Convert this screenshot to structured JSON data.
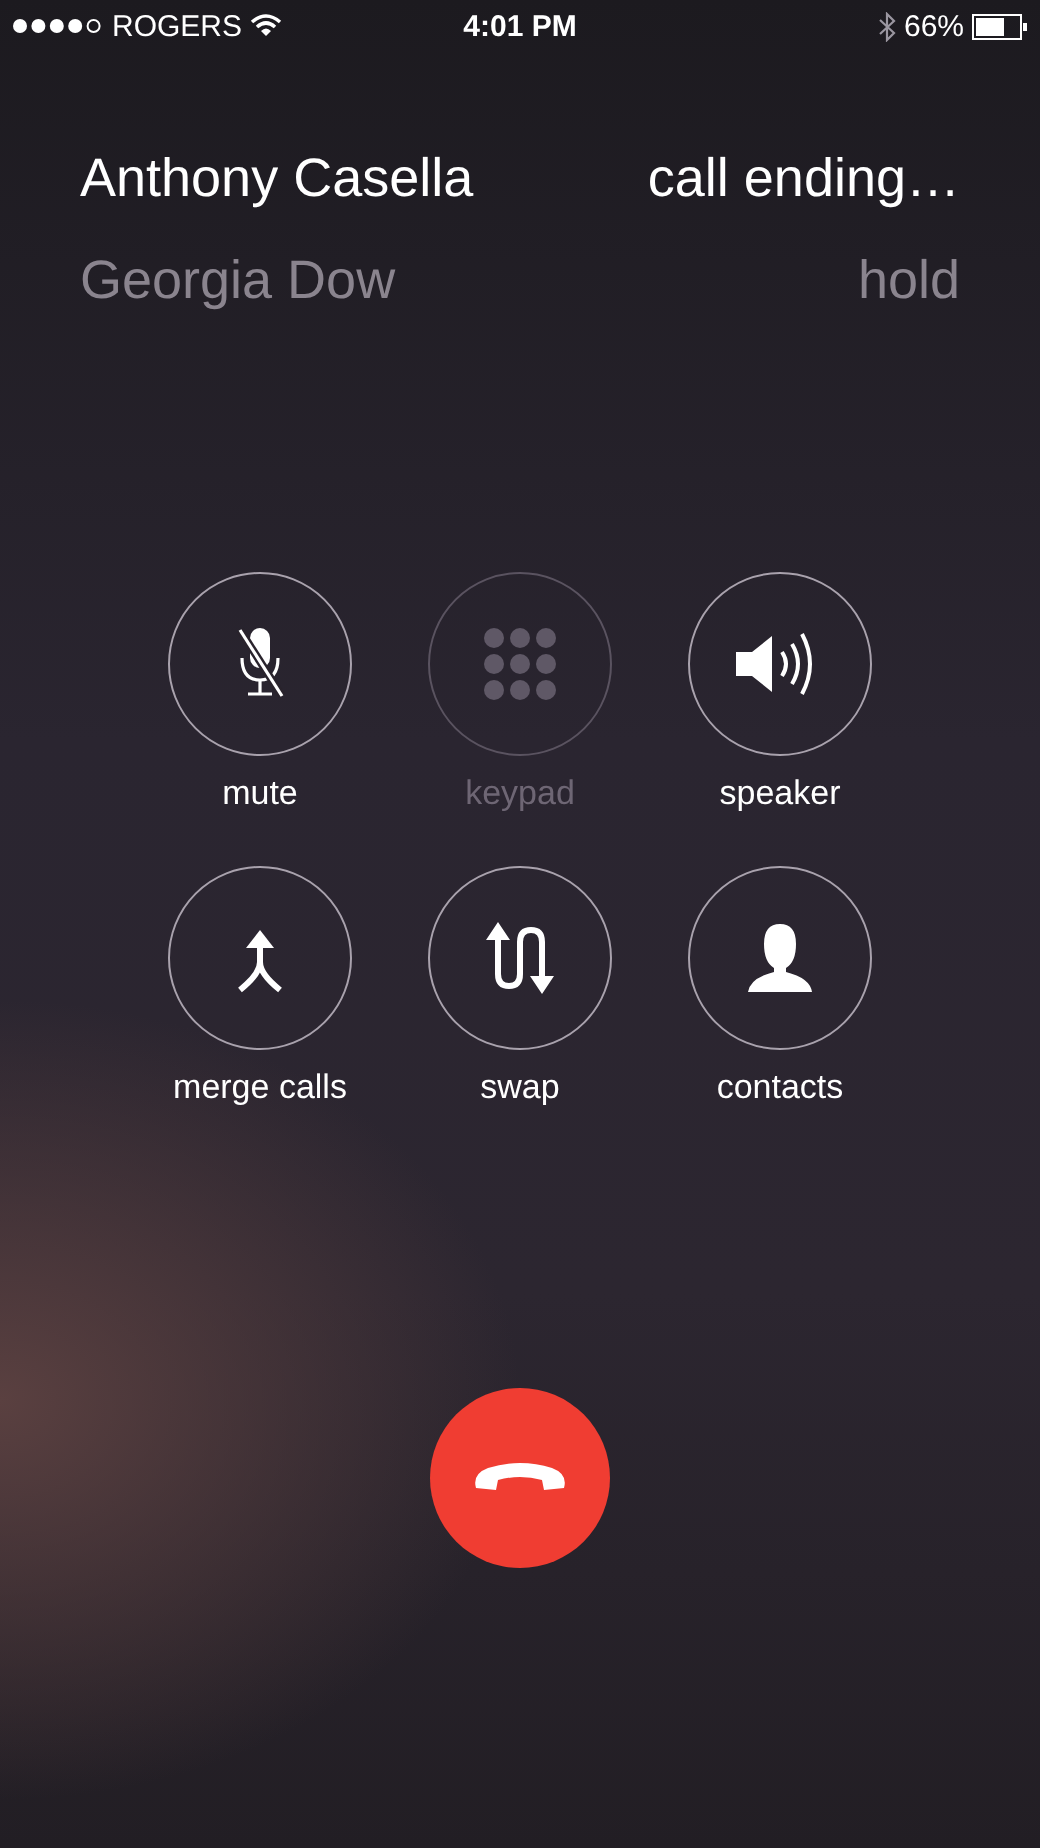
{
  "status_bar": {
    "carrier": "ROGERS",
    "time": "4:01 PM",
    "battery": "66%"
  },
  "calls": [
    {
      "name": "Anthony Casella",
      "status": "call ending…",
      "on_hold": false
    },
    {
      "name": "Georgia Dow",
      "status": "hold",
      "on_hold": true
    }
  ],
  "controls": [
    {
      "kind": "mute",
      "label": "mute",
      "disabled": false
    },
    {
      "kind": "keypad",
      "label": "keypad",
      "disabled": true
    },
    {
      "kind": "speaker",
      "label": "speaker",
      "disabled": false
    },
    {
      "kind": "merge",
      "label": "merge calls",
      "disabled": false
    },
    {
      "kind": "swap",
      "label": "swap",
      "disabled": false
    },
    {
      "kind": "contacts",
      "label": "contacts",
      "disabled": false
    }
  ]
}
